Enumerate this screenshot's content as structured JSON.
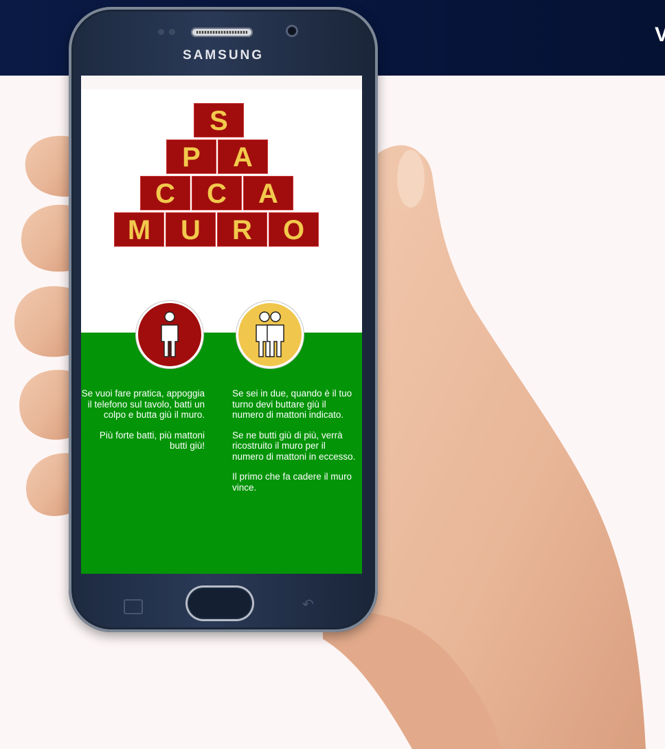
{
  "page": {
    "side_text": "V"
  },
  "device": {
    "brand": "SAMSUNG"
  },
  "app": {
    "logo_bricks": [
      {
        "letter": "S"
      },
      {
        "letter": "P"
      },
      {
        "letter": "A"
      },
      {
        "letter": "C"
      },
      {
        "letter": "C"
      },
      {
        "letter": "A"
      },
      {
        "letter": "M"
      },
      {
        "letter": "U"
      },
      {
        "letter": "R"
      },
      {
        "letter": "O"
      }
    ],
    "single_player": {
      "paragraphs": [
        "Se vuoi fare pratica, appoggia il telefono sul tavolo, batti un colpo e butta giù il muro.",
        "Più forte batti, più mattoni butti giù!"
      ]
    },
    "two_players": {
      "paragraphs": [
        "Se sei in due, quando è il tuo turno devi buttare giù il numero di mattoni indicato.",
        "Se ne butti giù di più, verrà ricostruito il muro per il numero di mattoni in eccesso.",
        "Il primo che fa cadere il muro vince."
      ]
    },
    "colors": {
      "brick": "#a10d0d",
      "letter": "#f2c94c",
      "field": "#049408",
      "two_player_circle": "#f0c64c"
    }
  },
  "icons": {
    "single_player_icon": "person-icon",
    "two_players_icon": "two-people-icon"
  }
}
